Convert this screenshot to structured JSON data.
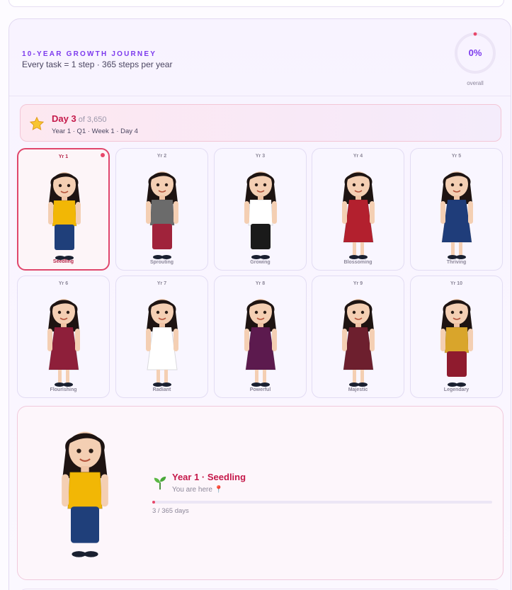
{
  "journey": {
    "title": "10-YEAR GROWTH JOURNEY",
    "subtitle": "Every task = 1 step · 365 steps per year",
    "overall_percent": "0%",
    "overall_label": "overall"
  },
  "day_banner": {
    "day_label": "Day 3",
    "of_label": "of 3,650",
    "position": "Year 1 · Q1 · Week 1 · Day 4",
    "icon": "star-icon"
  },
  "years": [
    {
      "label": "Yr 1",
      "stage": "Seedling",
      "outfit": "#f2b705",
      "bottom": "#1f3f7a",
      "active": true
    },
    {
      "label": "Yr 2",
      "stage": "Sprouting",
      "outfit": "#6b6b6b",
      "bottom": "#a0233b",
      "active": false
    },
    {
      "label": "Yr 3",
      "stage": "Growing",
      "outfit": "#ffffff",
      "bottom": "#1a1a1a",
      "active": false
    },
    {
      "label": "Yr 4",
      "stage": "Blossoming",
      "outfit": "#b3202e",
      "bottom": "#b3202e",
      "active": false
    },
    {
      "label": "Yr 5",
      "stage": "Thriving",
      "outfit": "#1f3d7a",
      "bottom": "#1f3d7a",
      "active": false
    },
    {
      "label": "Yr 6",
      "stage": "Flourishing",
      "outfit": "#8e1f3a",
      "bottom": "#8e1f3a",
      "active": false
    },
    {
      "label": "Yr 7",
      "stage": "Radiant",
      "outfit": "#ffffff",
      "bottom": "#ffffff",
      "active": false
    },
    {
      "label": "Yr 8",
      "stage": "Powerful",
      "outfit": "#5c1a4e",
      "bottom": "#5c1a4e",
      "active": false
    },
    {
      "label": "Yr 9",
      "stage": "Majestic",
      "outfit": "#6d1f2e",
      "bottom": "#6d1f2e",
      "active": false
    },
    {
      "label": "Yr 10",
      "stage": "Legendary",
      "outfit": "#d9a52b",
      "bottom": "#8f1b2e",
      "active": false
    }
  ],
  "current": {
    "title": "Year 1 · Seedling",
    "subtitle": "You are here 📍",
    "progress_text": "3 / 365 days",
    "progress_fraction": 0.0082,
    "icon": "sprout-icon"
  },
  "colors": {
    "accent": "#7c3aed",
    "highlight": "#c5194a",
    "active_border": "#e0476c"
  }
}
